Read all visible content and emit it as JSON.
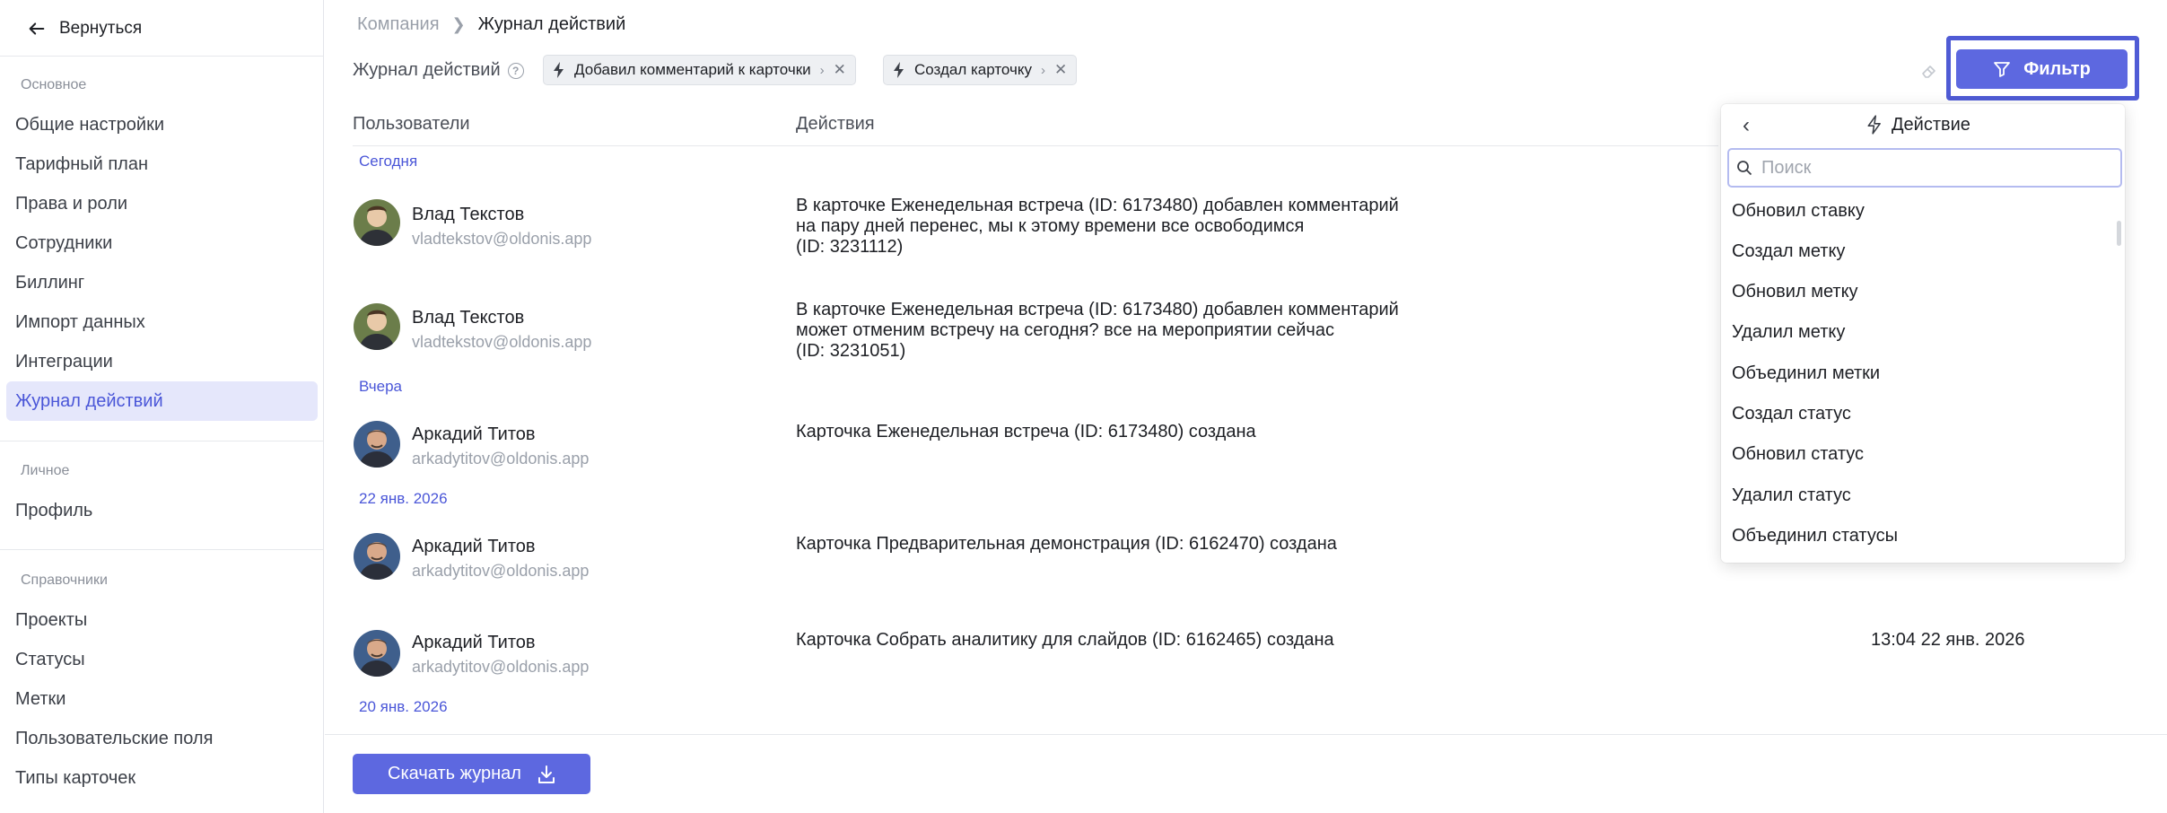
{
  "sidebar": {
    "back_label": "Вернуться",
    "section_main": "Основное",
    "main_items": [
      "Общие настройки",
      "Тарифный план",
      "Права и роли",
      "Сотрудники",
      "Биллинг",
      "Импорт данных",
      "Интеграции",
      "Журнал действий"
    ],
    "section_personal": "Личное",
    "personal_items": [
      "Профиль"
    ],
    "section_refs": "Справочники",
    "ref_items": [
      "Проекты",
      "Статусы",
      "Метки",
      "Пользовательские поля",
      "Типы карточек"
    ]
  },
  "breadcrumb": {
    "parent": "Компания",
    "current": "Журнал действий"
  },
  "toolbar": {
    "journal_label": "Журнал действий",
    "chips": [
      "Добавил комментарий к карточки",
      "Создал карточку"
    ],
    "filter_label": "Фильтр"
  },
  "table": {
    "col_users": "Пользователи",
    "col_actions": "Действия",
    "date_today": "Сегодня",
    "date_yesterday": "Вчера",
    "date_jan22": "22 янв. 2026",
    "date_jan20": "20 янв. 2026",
    "rows": [
      {
        "name": "Влад Текстов",
        "email": "vladtekstov@oldonis.app",
        "action": "В карточке Еженедельная встреча (ID: 6173480) добавлен комментарий\nна пару дней перенес, мы к этому времени все освободимся\n(ID: 3231112)",
        "time": ""
      },
      {
        "name": "Влад Текстов",
        "email": "vladtekstov@oldonis.app",
        "action": "В карточке Еженедельная встреча (ID: 6173480) добавлен комментарий\nможет отменим встречу на сегодня? все на мероприятии сейчас\n(ID: 3231051)",
        "time": ""
      },
      {
        "name": "Аркадий Титов",
        "email": "arkadytitov@oldonis.app",
        "action": "Карточка Еженедельная встреча (ID: 6173480) создана",
        "time": ""
      },
      {
        "name": "Аркадий Титов",
        "email": "arkadytitov@oldonis.app",
        "action": "Карточка Предварительная демонстрация (ID: 6162470) создана",
        "time": ""
      },
      {
        "name": "Аркадий Титов",
        "email": "arkadytitov@oldonis.app",
        "action": "Карточка Собрать аналитику для слайдов (ID: 6162465) создана",
        "time": "13:04 22 янв. 2026"
      }
    ]
  },
  "footer": {
    "download_label": "Скачать журнал"
  },
  "dropdown": {
    "title": "Действие",
    "search_placeholder": "Поиск",
    "search_value": "",
    "items": [
      "Обновил ставку",
      "Создал метку",
      "Обновил метку",
      "Удалил метку",
      "Объединил метки",
      "Создал статус",
      "Обновил статус",
      "Удалил статус",
      "Объединил статусы"
    ]
  },
  "colors": {
    "accent": "#5d68e0",
    "accent_text": "#4a56d8",
    "active_bg": "#e5e7fb",
    "muted": "#9aa0aa"
  }
}
